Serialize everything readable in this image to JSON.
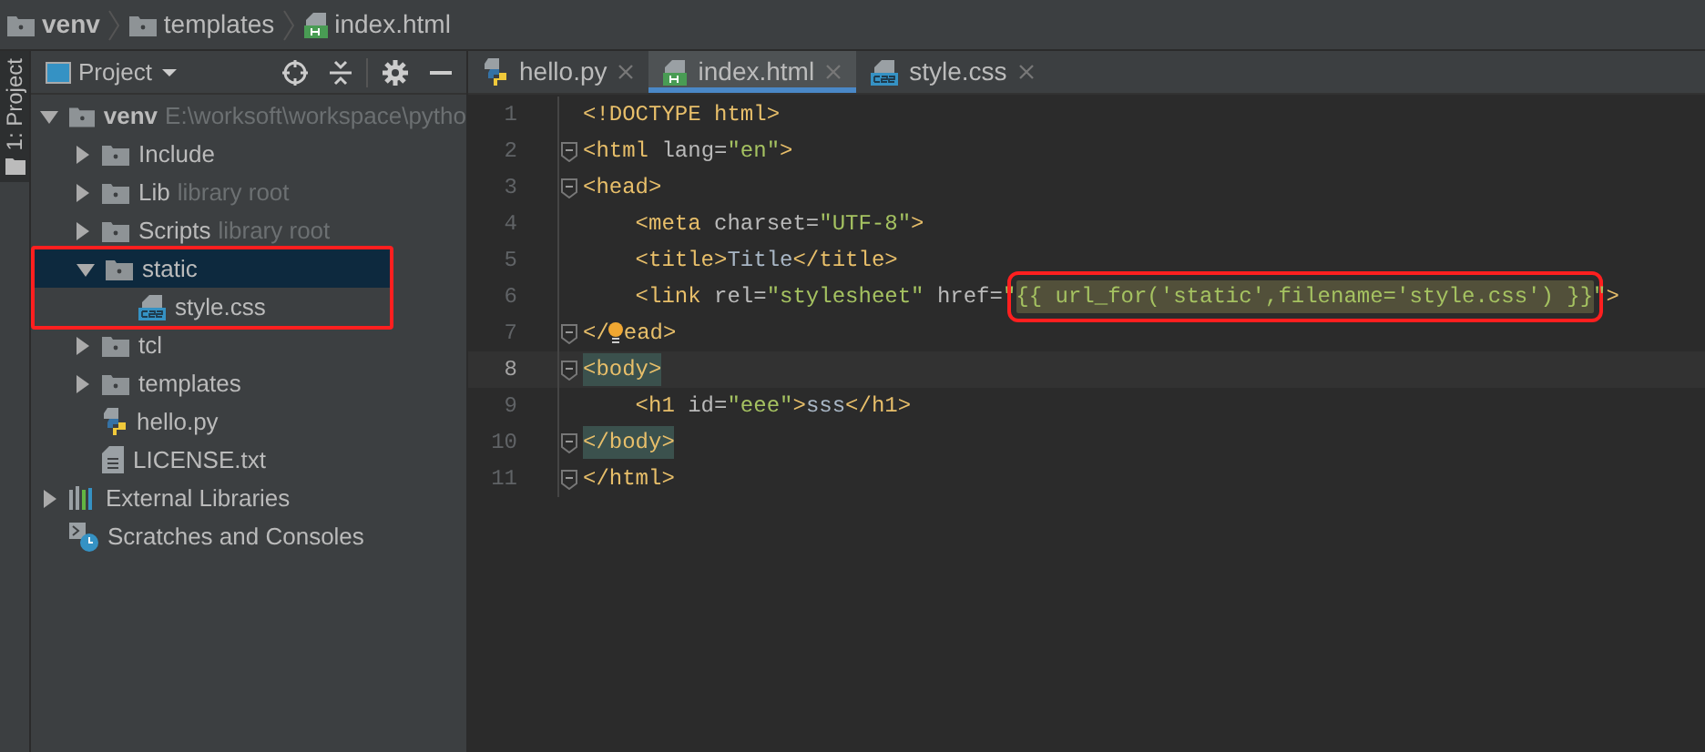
{
  "breadcrumbs": [
    {
      "label": "venv",
      "kind": "folder",
      "bold": true
    },
    {
      "label": "templates",
      "kind": "folder",
      "bold": false
    },
    {
      "label": "index.html",
      "kind": "html",
      "bold": false
    }
  ],
  "side_tab": {
    "label": "1: Project"
  },
  "project_panel": {
    "title": "Project"
  },
  "tree": [
    {
      "label": "venv",
      "hint": "E:\\worksoft\\workspace\\pytho",
      "kind": "folder",
      "expanded": true,
      "selected": false,
      "highlighted": false,
      "children": [
        {
          "label": "Include",
          "kind": "folder",
          "expanded": false,
          "selected": false,
          "highlighted": false
        },
        {
          "label": "Lib",
          "hint": "library root",
          "kind": "folder",
          "expanded": false,
          "selected": false,
          "highlighted": false
        },
        {
          "label": "Scripts",
          "hint": "library root",
          "kind": "folder",
          "expanded": false,
          "selected": false,
          "highlighted": false
        },
        {
          "label": "static",
          "kind": "folder",
          "expanded": true,
          "selected": true,
          "highlighted": true,
          "children": [
            {
              "label": "style.css",
              "kind": "css",
              "selected": false,
              "highlighted": false
            }
          ]
        },
        {
          "label": "tcl",
          "kind": "folder",
          "expanded": false,
          "selected": false,
          "highlighted": false
        },
        {
          "label": "templates",
          "kind": "folder",
          "expanded": false,
          "selected": false,
          "highlighted": false
        },
        {
          "label": "hello.py",
          "kind": "python",
          "selected": false,
          "highlighted": false
        },
        {
          "label": "LICENSE.txt",
          "kind": "text",
          "selected": false,
          "highlighted": false
        }
      ]
    },
    {
      "label": "External Libraries",
      "kind": "libraries",
      "expanded": false,
      "selected": false,
      "highlighted": false
    },
    {
      "label": "Scratches and Consoles",
      "kind": "scratches",
      "selected": false,
      "highlighted": false
    }
  ],
  "tabs": [
    {
      "label": "hello.py",
      "kind": "python",
      "selected": false
    },
    {
      "label": "index.html",
      "kind": "html",
      "selected": true
    },
    {
      "label": "style.css",
      "kind": "css",
      "selected": false
    }
  ],
  "code_lines": [
    {
      "number": "1",
      "current": false,
      "fold": false,
      "tokens": [
        {
          "kind": "tag",
          "text": "<!DOCTYPE html>"
        }
      ]
    },
    {
      "number": "2",
      "current": false,
      "fold": true,
      "tokens": [
        {
          "kind": "tag",
          "text": "<html "
        },
        {
          "kind": "attr",
          "text": "lang="
        },
        {
          "kind": "string",
          "text": "\"en\""
        },
        {
          "kind": "tag",
          "text": ">"
        }
      ]
    },
    {
      "number": "3",
      "current": false,
      "fold": true,
      "tokens": [
        {
          "kind": "tag",
          "text": "<head>"
        }
      ]
    },
    {
      "number": "4",
      "current": false,
      "fold": false,
      "indented": true,
      "tokens": [
        {
          "kind": "tag",
          "text": "<meta "
        },
        {
          "kind": "attr",
          "text": "charset="
        },
        {
          "kind": "string",
          "text": "\"UTF-8\""
        },
        {
          "kind": "tag",
          "text": ">"
        }
      ]
    },
    {
      "number": "5",
      "current": false,
      "fold": false,
      "indented": true,
      "tokens": [
        {
          "kind": "tag",
          "text": "<title>"
        },
        {
          "kind": "text",
          "text": "Title"
        },
        {
          "kind": "tag",
          "text": "</title>"
        }
      ]
    },
    {
      "number": "6",
      "current": false,
      "fold": false,
      "indented": true,
      "tokens": [
        {
          "kind": "tag",
          "text": "<link "
        },
        {
          "kind": "attr",
          "text": "rel="
        },
        {
          "kind": "string",
          "text": "\"stylesheet\" "
        },
        {
          "kind": "attr",
          "text": "href="
        },
        {
          "kind": "string",
          "text": "\""
        },
        {
          "kind": "template",
          "text": "{{ url_for('static',filename='style.css') }}",
          "highlighted": true
        },
        {
          "kind": "string",
          "text": "\""
        },
        {
          "kind": "tag",
          "text": ">"
        }
      ]
    },
    {
      "number": "7",
      "current": false,
      "fold": true,
      "tokens": [
        {
          "kind": "tag",
          "text": "</"
        },
        {
          "kind": "bulb"
        },
        {
          "kind": "tag",
          "text": "ead>"
        }
      ]
    },
    {
      "number": "8",
      "current": true,
      "fold": true,
      "tokens": [
        {
          "kind": "matched",
          "text": "<body>"
        }
      ]
    },
    {
      "number": "9",
      "current": false,
      "fold": false,
      "indented": true,
      "tokens": [
        {
          "kind": "tag",
          "text": "<h1 "
        },
        {
          "kind": "attr",
          "text": "id="
        },
        {
          "kind": "string",
          "text": "\"eee\""
        },
        {
          "kind": "tag",
          "text": ">"
        },
        {
          "kind": "text",
          "text": "sss"
        },
        {
          "kind": "tag",
          "text": "</h1>"
        }
      ]
    },
    {
      "number": "10",
      "current": false,
      "fold": true,
      "tokens": [
        {
          "kind": "matched",
          "text": "</body>"
        }
      ]
    },
    {
      "number": "11",
      "current": false,
      "fold": true,
      "tokens": [
        {
          "kind": "tag",
          "text": "</html>"
        }
      ]
    }
  ]
}
